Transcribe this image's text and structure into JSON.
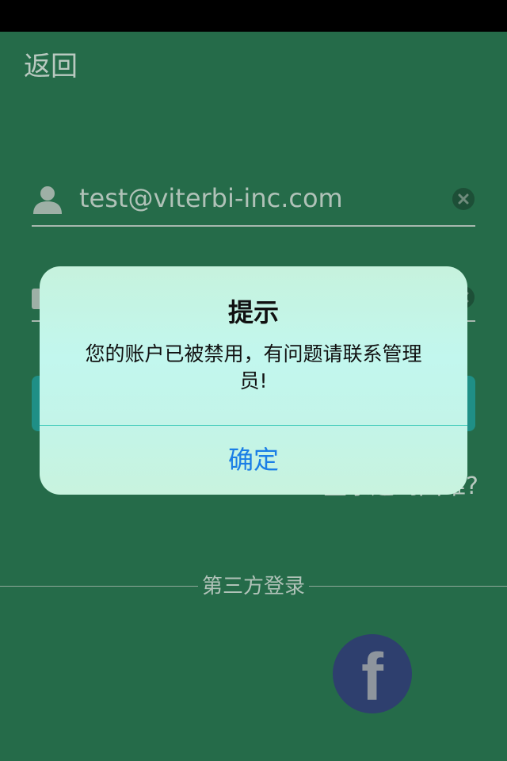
{
  "header": {
    "back_label": "返回"
  },
  "form": {
    "email_value": "test@viterbi-inc.com",
    "trouble_label": "登录遇到困难?"
  },
  "third_party": {
    "label": "第三方登录",
    "facebook_glyph": "f"
  },
  "alert": {
    "title": "提示",
    "message": "您的账户已被禁用，有问题请联系管理员!",
    "confirm_label": "确定"
  },
  "colors": {
    "background": "#256b49",
    "accent": "#1a7ee6",
    "facebook": "#2e3f6e"
  }
}
